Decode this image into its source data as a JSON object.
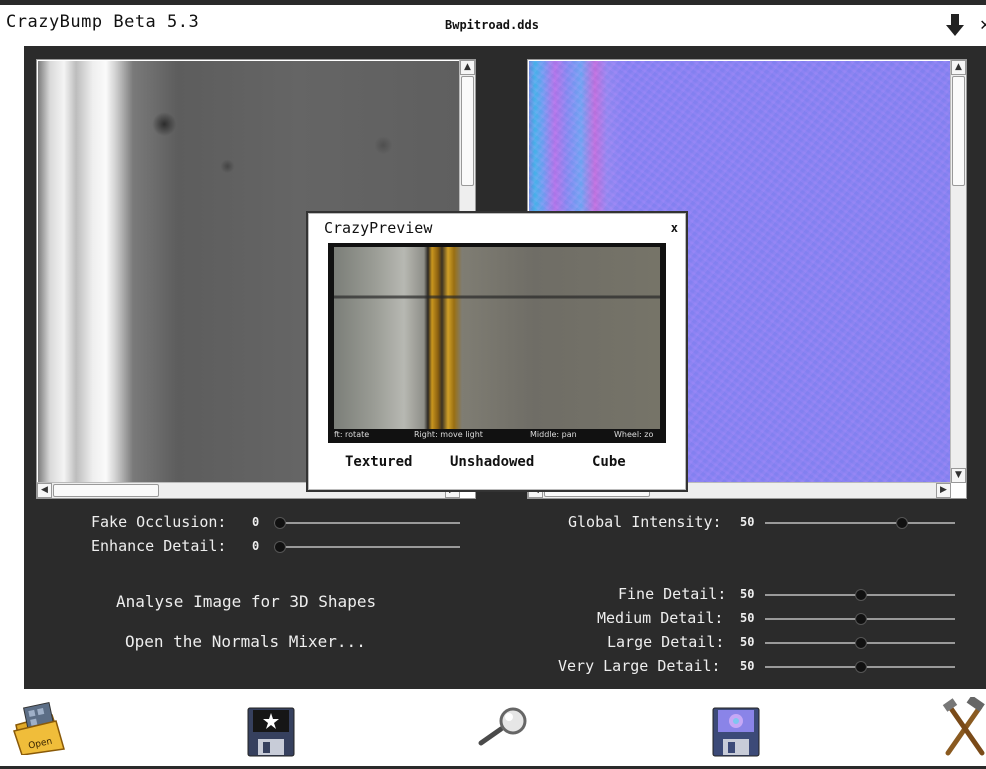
{
  "app": {
    "title": "CrazyBump Beta 5.3",
    "file_name": "Bwpitroad.dds"
  },
  "left_controls": [
    {
      "label": "Fake Occlusion:",
      "value": "0",
      "level": 0
    },
    {
      "label": "Enhance Detail:",
      "value": "0",
      "level": 0
    }
  ],
  "right_controls": [
    {
      "label": "Global Intensity:",
      "value": "50",
      "level": 0.73
    },
    {
      "label": "Fine Detail:",
      "value": "50",
      "level": 0.5
    },
    {
      "label": "Medium Detail:",
      "value": "50",
      "level": 0.5
    },
    {
      "label": "Large Detail:",
      "value": "50",
      "level": 0.5
    },
    {
      "label": "Very Large Detail:",
      "value": "50",
      "level": 0.5
    }
  ],
  "actions": {
    "analyse": "Analyse Image for 3D Shapes",
    "normals_mixer": "Open the Normals Mixer..."
  },
  "preview": {
    "title": "CrazyPreview",
    "close": "x",
    "hints": [
      "ft: rotate",
      "Right: move light",
      "Middle: pan",
      "Wheel: zo"
    ],
    "modes": [
      "Textured",
      "Unshadowed",
      "Cube"
    ]
  },
  "toolbar": {
    "open_label": "Open",
    "icons": [
      "open-folder-icon",
      "save-heightmap-icon",
      "magnifier-icon",
      "save-normalmap-icon",
      "tools-icon"
    ]
  },
  "colors": {
    "panel_bg": "#2b2b2b",
    "label_text": "#eeeeee",
    "accent_yellow": "#e6b400"
  }
}
